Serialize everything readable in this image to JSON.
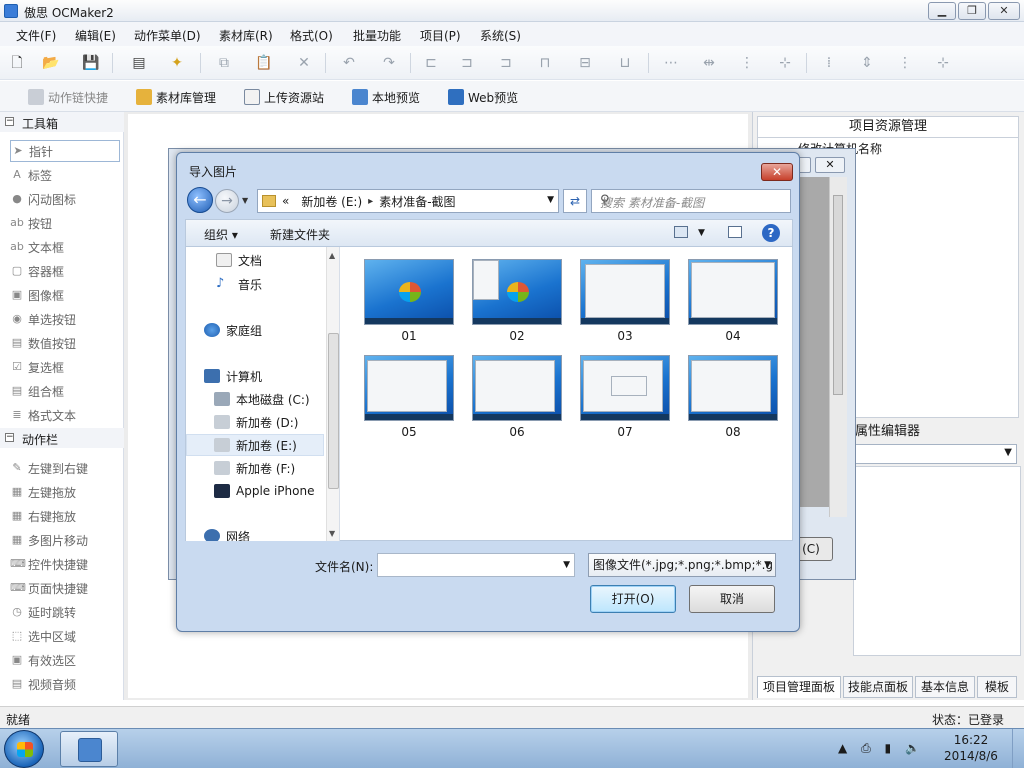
{
  "app": {
    "title": "傲思 OCMaker2",
    "status_left": "就绪",
    "status_right": "状态：已登录"
  },
  "menu": [
    "文件(F)",
    "编辑(E)",
    "动作菜单(D)",
    "素材库(R)",
    "格式(O)",
    "批量功能",
    "项目(P)",
    "系统(S)"
  ],
  "toolbar2": [
    "动作链快捷",
    "素材库管理",
    "上传资源站",
    "本地预览",
    "Web预览"
  ],
  "toolbox": {
    "section1": "工具箱",
    "items1": [
      "指针",
      "标签",
      "闪动图标",
      "按钮",
      "文本框",
      "容器框",
      "图像框",
      "单选按钮",
      "数值按钮",
      "复选框",
      "组合框",
      "格式文本"
    ],
    "section2": "动作栏",
    "items2": [
      "左键到右键",
      "左键拖放",
      "右键拖放",
      "多图片移动",
      "控件快捷键",
      "页面快捷键",
      "延时跳转",
      "选中区域",
      "有效选区",
      "视频音频"
    ]
  },
  "right_panel": {
    "title": "项目资源管理",
    "tree_item": "修改计算机名称",
    "prop_title": "属性编辑器",
    "tabs": [
      "项目管理面板",
      "技能点面板",
      "基本信息",
      "模板"
    ]
  },
  "bg_dialog": {
    "button": "(C)"
  },
  "dialog": {
    "title": "导入图片",
    "close": "✕",
    "path": [
      "«",
      "新加卷 (E:)",
      "素材准备-截图"
    ],
    "search_placeholder": "搜索 素材准备-截图",
    "organize": "组织 ▾",
    "new_folder": "新建文件夹",
    "nav": [
      "文档",
      "音乐",
      "家庭组",
      "计算机",
      "本地磁盘 (C:)",
      "新加卷 (D:)",
      "新加卷 (E:)",
      "新加卷 (F:)",
      "Apple iPhone",
      "网络"
    ],
    "thumbs": [
      "01",
      "02",
      "03",
      "04",
      "05",
      "06",
      "07",
      "08"
    ],
    "filename_label": "文件名(N):",
    "filename_value": "",
    "filetype": "图像文件(*.jpg;*.png;*.bmp;*.g",
    "open": "打开(O)",
    "cancel": "取消"
  },
  "taskbar": {
    "time": "16:22",
    "date": "2014/8/6"
  }
}
